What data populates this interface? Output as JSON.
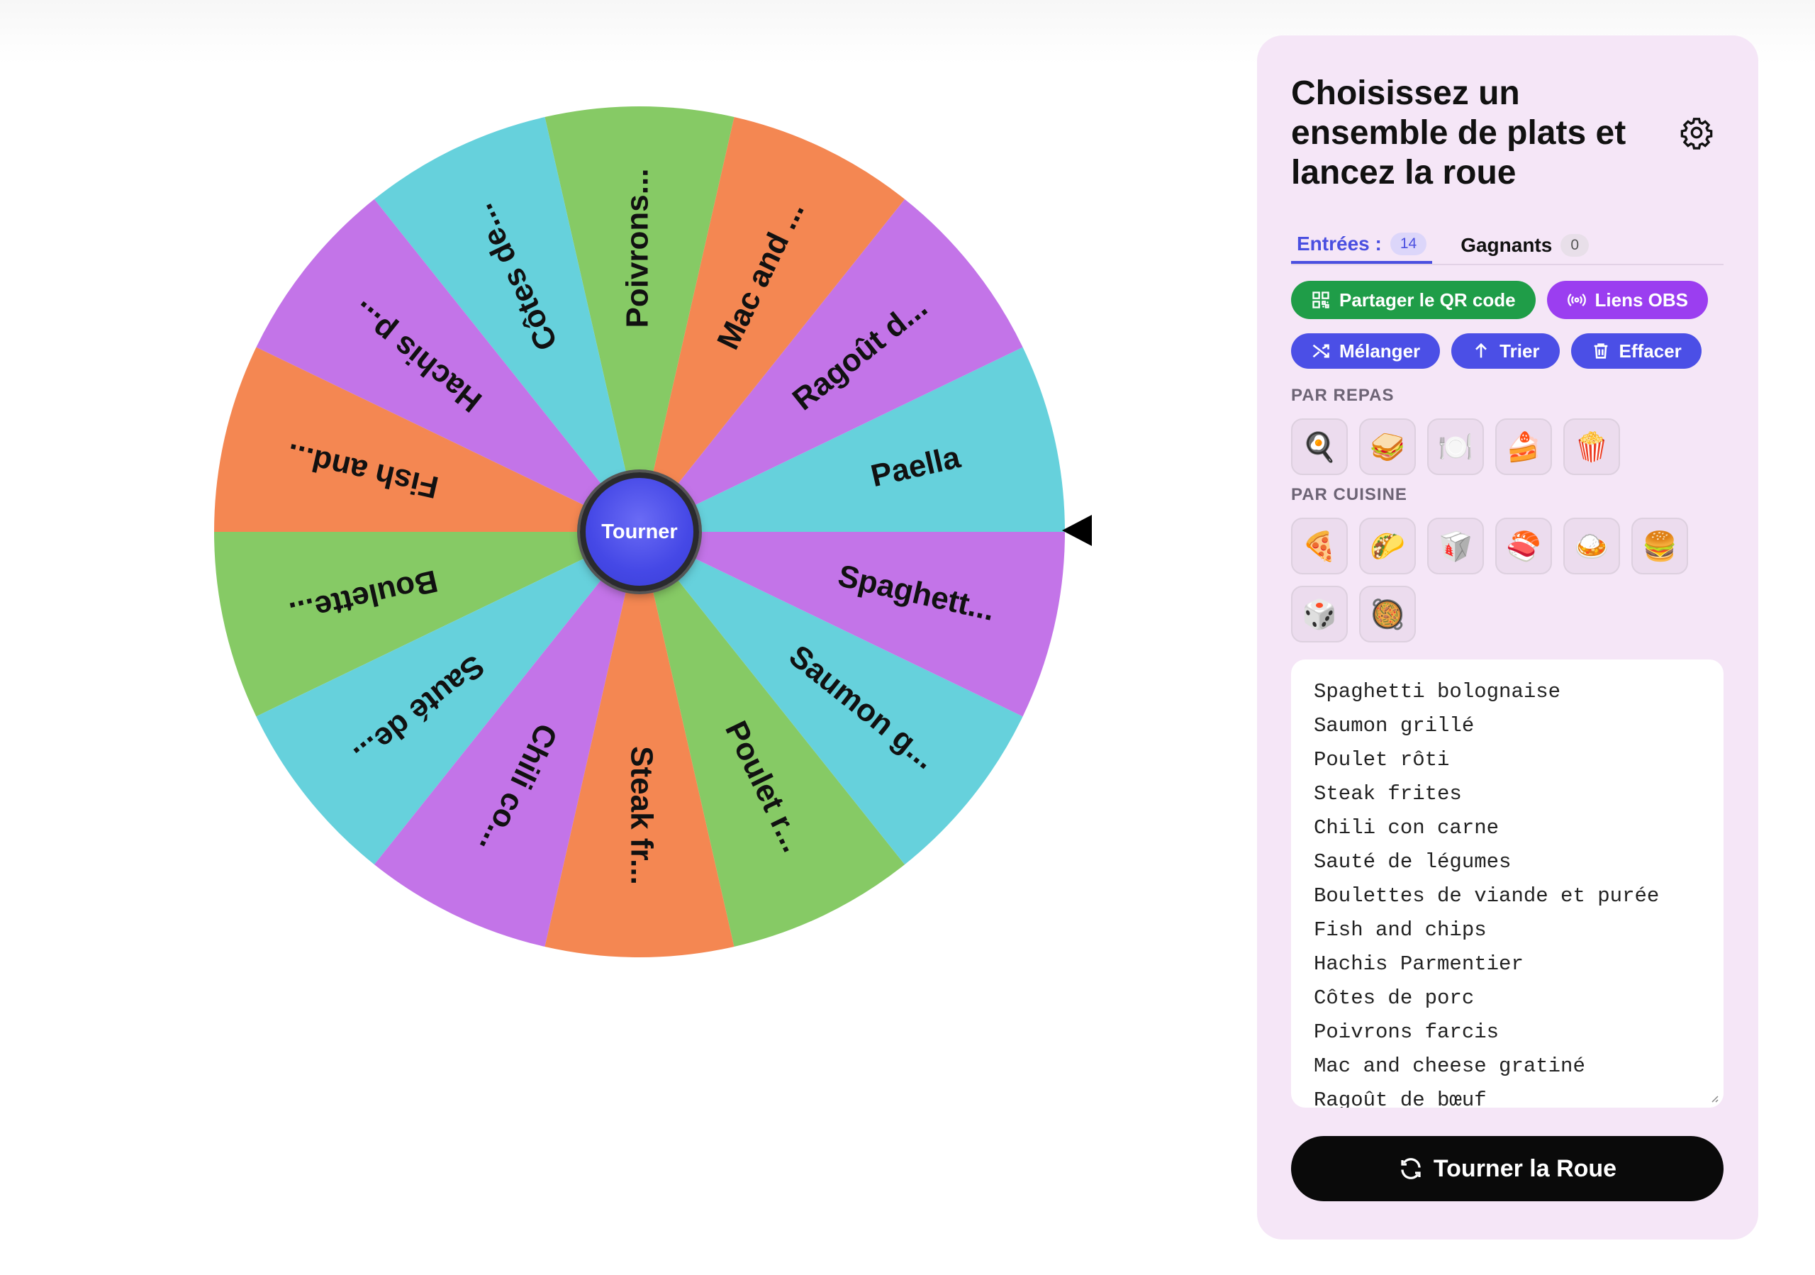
{
  "wheel": {
    "center_button_label": "Tourner",
    "segments": [
      {
        "label": "Paella",
        "color": "#66d1dc"
      },
      {
        "label": "Ragoût d...",
        "color": "#c374e8"
      },
      {
        "label": "Mac and ...",
        "color": "#f48752"
      },
      {
        "label": "Poivrons...",
        "color": "#86ca65"
      },
      {
        "label": "Côtes de...",
        "color": "#66d1dc"
      },
      {
        "label": "Hachis p...",
        "color": "#c374e8"
      },
      {
        "label": "Fish and...",
        "color": "#f48752"
      },
      {
        "label": "Boulette...",
        "color": "#86ca65"
      },
      {
        "label": "Sauté de...",
        "color": "#66d1dc"
      },
      {
        "label": "Chili co...",
        "color": "#c374e8"
      },
      {
        "label": "Steak fr...",
        "color": "#f48752"
      },
      {
        "label": "Poulet r...",
        "color": "#86ca65"
      },
      {
        "label": "Saumon g...",
        "color": "#66d1dc"
      },
      {
        "label": "Spaghett...",
        "color": "#c374e8"
      }
    ]
  },
  "panel": {
    "title": "Choisissez un ensemble de plats et lancez la roue",
    "tabs": [
      {
        "label": "Entrées :",
        "count": "14",
        "active": true
      },
      {
        "label": "Gagnants",
        "count": "0",
        "active": false
      }
    ],
    "share_buttons": [
      {
        "label": "Partager le QR code",
        "icon": "qr-code-icon"
      },
      {
        "label": "Liens OBS",
        "icon": "broadcast-icon"
      }
    ],
    "action_buttons": [
      {
        "label": "Mélanger",
        "icon": "shuffle-icon"
      },
      {
        "label": "Trier",
        "icon": "arrow-up-icon"
      },
      {
        "label": "Effacer",
        "icon": "trash-icon"
      }
    ],
    "by_meal_label": "PAR REPAS",
    "by_meal": [
      "🍳",
      "🥪",
      "🍽️",
      "🍰",
      "🍿"
    ],
    "by_cuisine_label": "PAR CUISINE",
    "by_cuisine": [
      "🍕",
      "🌮",
      "🥡",
      "🍣",
      "🍛",
      "🍔",
      "🎲",
      "🥘"
    ],
    "entries": [
      "Spaghetti bolognaise",
      "Saumon grillé",
      "Poulet rôti",
      "Steak frites",
      "Chili con carne",
      "Sauté de légumes",
      "Boulettes de viande et purée",
      "Fish and chips",
      "Hachis Parmentier",
      "Côtes de porc",
      "Poivrons farcis",
      "Mac and cheese gratiné",
      "Ragoût de bœuf"
    ],
    "spin_button_label": "Tourner la Roue",
    "accent_color": "#4a4fe0"
  }
}
